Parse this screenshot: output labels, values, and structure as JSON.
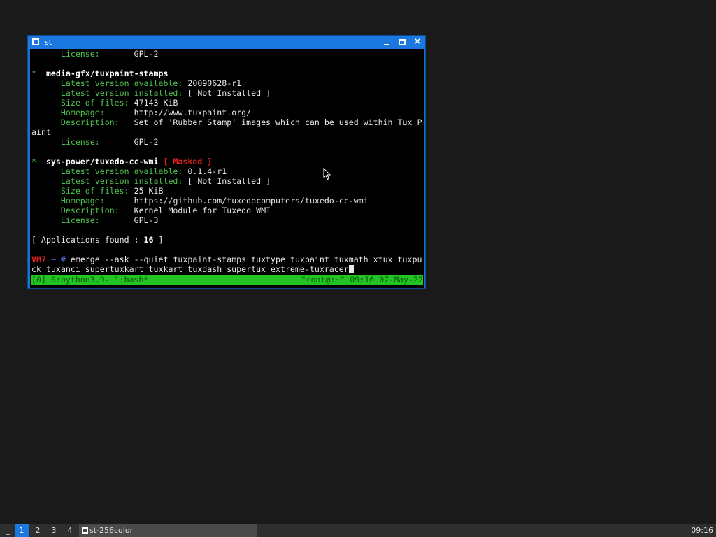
{
  "window": {
    "title": "st",
    "terminal_lines": [
      [
        {
          "t": "      ",
          "c": ""
        },
        {
          "t": "License:",
          "c": "g"
        },
        {
          "t": "       GPL-2",
          "c": "w"
        }
      ],
      [
        {
          "t": "",
          "c": ""
        }
      ],
      [
        {
          "t": "*",
          "c": "g"
        },
        {
          "t": "  media-gfx/tuxpaint-stamps",
          "c": "b"
        }
      ],
      [
        {
          "t": "      ",
          "c": ""
        },
        {
          "t": "Latest version available:",
          "c": "g"
        },
        {
          "t": " 20090628-r1",
          "c": "w"
        }
      ],
      [
        {
          "t": "      ",
          "c": ""
        },
        {
          "t": "Latest version installed:",
          "c": "g"
        },
        {
          "t": " [ Not Installed ]",
          "c": "w"
        }
      ],
      [
        {
          "t": "      ",
          "c": ""
        },
        {
          "t": "Size of files:",
          "c": "g"
        },
        {
          "t": " 47143 KiB",
          "c": "w"
        }
      ],
      [
        {
          "t": "      ",
          "c": ""
        },
        {
          "t": "Homepage:",
          "c": "g"
        },
        {
          "t": "      http://www.tuxpaint.org/",
          "c": "w"
        }
      ],
      [
        {
          "t": "      ",
          "c": ""
        },
        {
          "t": "Description:",
          "c": "g"
        },
        {
          "t": "   Set of 'Rubber Stamp' images which can be used within Tux P",
          "c": "w"
        }
      ],
      [
        {
          "t": "aint",
          "c": "w"
        }
      ],
      [
        {
          "t": "      ",
          "c": ""
        },
        {
          "t": "License:",
          "c": "g"
        },
        {
          "t": "       GPL-2",
          "c": "w"
        }
      ],
      [
        {
          "t": "",
          "c": ""
        }
      ],
      [
        {
          "t": "*",
          "c": "g"
        },
        {
          "t": "  sys-power/tuxedo-cc-wmi",
          "c": "b"
        },
        {
          "t": " [ Masked ]",
          "c": "rb"
        }
      ],
      [
        {
          "t": "      ",
          "c": ""
        },
        {
          "t": "Latest version available:",
          "c": "g"
        },
        {
          "t": " 0.1.4-r1",
          "c": "w"
        }
      ],
      [
        {
          "t": "      ",
          "c": ""
        },
        {
          "t": "Latest version installed:",
          "c": "g"
        },
        {
          "t": " [ Not Installed ]",
          "c": "w"
        }
      ],
      [
        {
          "t": "      ",
          "c": ""
        },
        {
          "t": "Size of files:",
          "c": "g"
        },
        {
          "t": " 25 KiB",
          "c": "w"
        }
      ],
      [
        {
          "t": "      ",
          "c": ""
        },
        {
          "t": "Homepage:",
          "c": "g"
        },
        {
          "t": "      https://github.com/tuxedocomputers/tuxedo-cc-wmi",
          "c": "w"
        }
      ],
      [
        {
          "t": "      ",
          "c": ""
        },
        {
          "t": "Description:",
          "c": "g"
        },
        {
          "t": "   Kernel Module for Tuxedo WMI",
          "c": "w"
        }
      ],
      [
        {
          "t": "      ",
          "c": ""
        },
        {
          "t": "License:",
          "c": "g"
        },
        {
          "t": "       GPL-3",
          "c": "w"
        }
      ],
      [
        {
          "t": "",
          "c": ""
        }
      ],
      [
        {
          "t": "[ Applications found : ",
          "c": "w"
        },
        {
          "t": "16",
          "c": "b"
        },
        {
          "t": " ]",
          "c": "w"
        }
      ],
      [
        {
          "t": "",
          "c": ""
        }
      ],
      [
        {
          "t": "VM7",
          "c": "rb"
        },
        {
          "t": " ~ # ",
          "c": "bl"
        },
        {
          "t": "emerge --ask --quiet tuxpaint-stamps tuxtype tuxpaint tuxmath xtux tuxpu",
          "c": "w"
        }
      ],
      [
        {
          "t": "ck tuxanci supertuxkart tuxkart tuxdash supertux extreme-tuxracer",
          "c": "w"
        },
        {
          "t": "",
          "c": "cursor"
        }
      ]
    ],
    "status_left": "[0] 0:python3.9- 1:bash*",
    "status_right": "\"root@:~\" 09:16 07-May-22"
  },
  "taskbar": {
    "layout_symbol": "_",
    "workspaces": [
      "1",
      "2",
      "3",
      "4"
    ],
    "active_workspace": "1",
    "task_title": "st-256color",
    "clock": "09:16"
  },
  "colors": {
    "accent": "#1a78e0",
    "terminal_bg": "#000000",
    "label_green": "#4fc34f",
    "masked_red": "#e02020",
    "status_green": "#22c322"
  }
}
